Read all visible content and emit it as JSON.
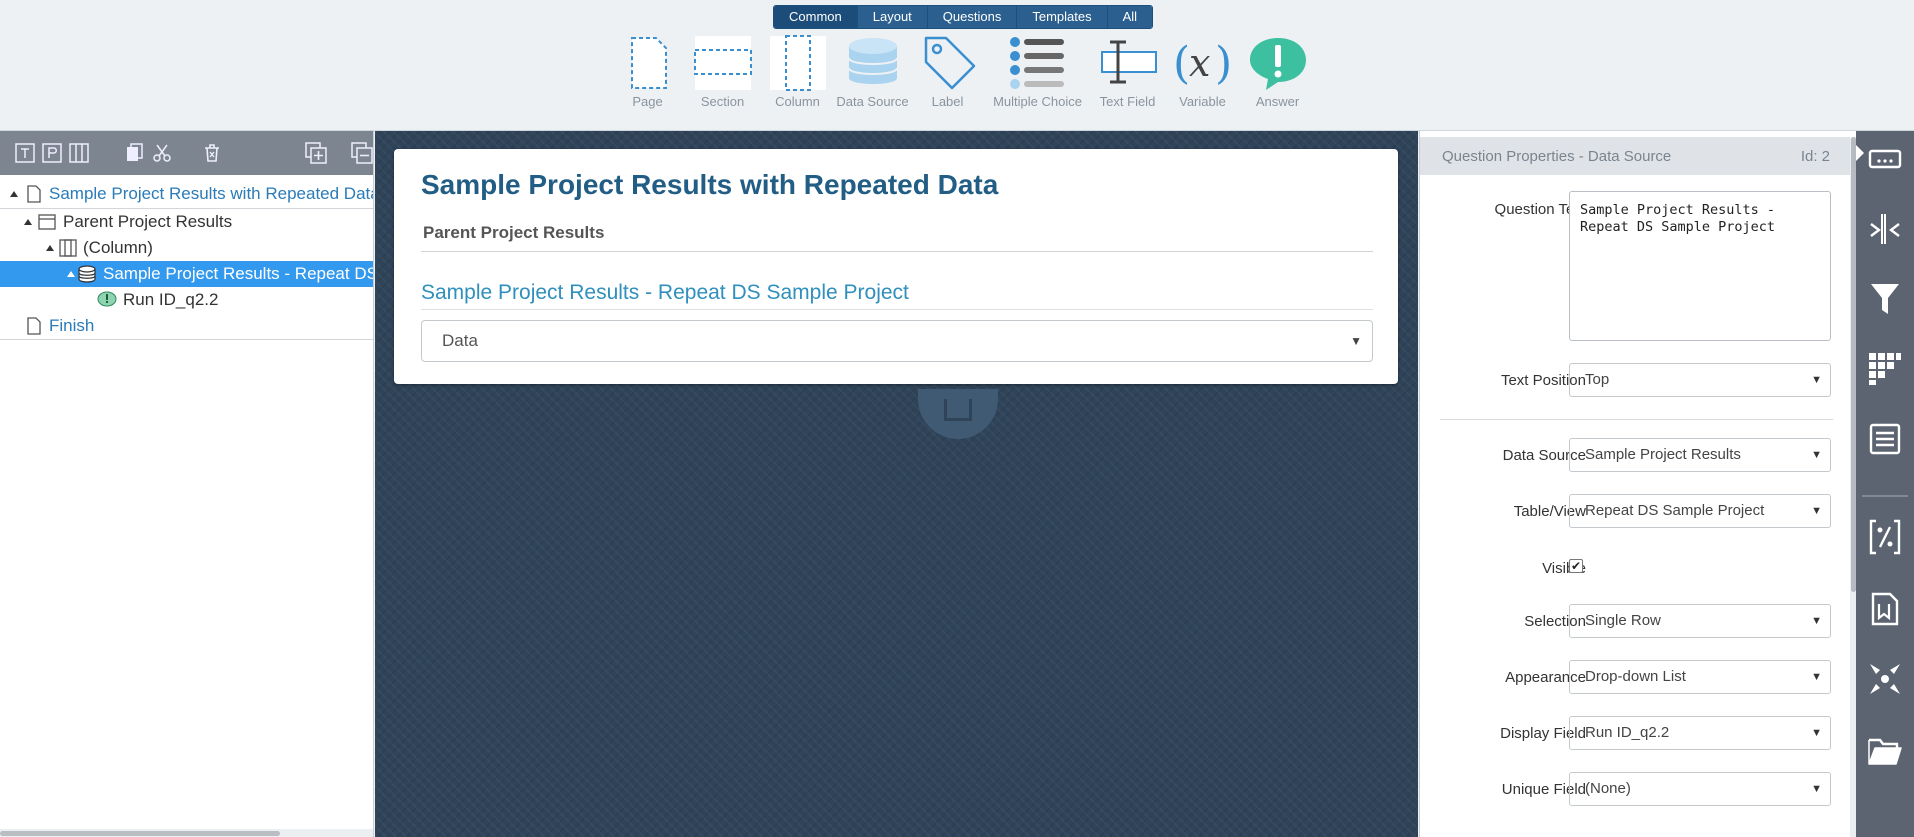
{
  "toolbar": {
    "tabs": [
      "Common",
      "Layout",
      "Questions",
      "Templates",
      "All"
    ],
    "tools": {
      "page": "Page",
      "section": "Section",
      "column": "Column",
      "data_source": "Data Source",
      "label": "Label",
      "multiple_choice": "Multiple Choice",
      "text_field": "Text Field",
      "variable": "Variable",
      "answer": "Answer"
    }
  },
  "tree": {
    "items": [
      "Sample Project Results with Repeated Data",
      "Parent Project Results",
      "(Column)",
      "Sample Project Results - Repeat DS Sample Project",
      "Run ID_q2.2",
      "Finish"
    ]
  },
  "canvas": {
    "title": "Sample Project Results with Repeated Data",
    "section": "Parent Project Results",
    "question": "Sample Project Results - Repeat DS Sample Project",
    "select_value": "Data"
  },
  "props": {
    "title": "Question Properties - Data Source",
    "id": "Id: 2",
    "question_text_label": "Question Text",
    "question_text": "Sample Project Results - Repeat DS Sample Project",
    "text_position_label": "Text Position",
    "text_position": "Top",
    "data_source_label": "Data Source",
    "data_source": "Sample Project Results",
    "table_view_label": "Table/View",
    "table_view": "Repeat DS Sample Project",
    "visible_label": "Visible",
    "visible": true,
    "selection_label": "Selection",
    "selection": "Single Row",
    "appearance_label": "Appearance",
    "appearance": "Drop-down List",
    "display_field_label": "Display Field",
    "display_field": "Run ID_q2.2",
    "unique_field_label": "Unique Field",
    "unique_field": "(None)"
  },
  "colors": {
    "accent": "#2a5f8f",
    "selection": "#3399ee",
    "canvas_bg": "#2f4459",
    "title": "#225d85",
    "link": "#2a7bb8",
    "answer_icon": "#3cc0a0"
  }
}
